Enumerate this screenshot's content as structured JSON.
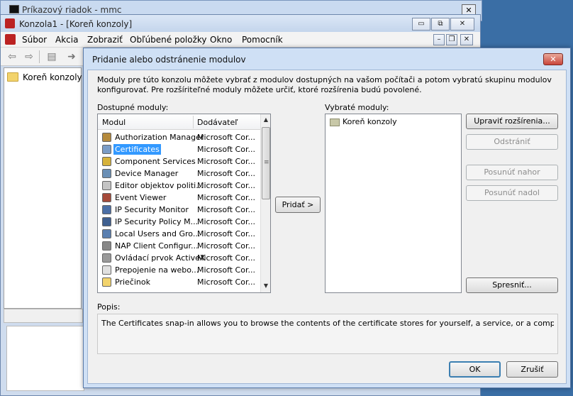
{
  "cmd_window": {
    "title": "Príkazový riadok - mmc",
    "close_label": "✕"
  },
  "console": {
    "title": "Konzola1 - [Koreň konzoly]",
    "menu": [
      "Súbor",
      "Akcia",
      "Zobraziť",
      "Obľúbené položky",
      "Okno",
      "Pomocník"
    ],
    "tree_root": "Koreň konzoly",
    "window_buttons": {
      "min": "▭",
      "max": "⧉",
      "close": "✕"
    },
    "mdi_buttons": {
      "min": "–",
      "max": "❐",
      "close": "✕"
    }
  },
  "dialog": {
    "title": "Pridanie alebo odstránenie modulov",
    "close_label": "✕",
    "description": "Moduly pre túto konzolu môžete vybrať z modulov dostupných na vašom počítači a potom vybratú skupinu modulov konfigurovať. Pre rozšíriteľné moduly môžete určiť, ktoré rozšírenia budú povolené.",
    "available_label": "Dostupné moduly:",
    "selected_label": "Vybraté moduly:",
    "columns": {
      "module": "Modul",
      "vendor": "Dodávateľ"
    },
    "available": [
      {
        "name": "Authorization Manager",
        "vendor": "Microsoft Cor...",
        "icon": "authorization-manager-icon",
        "color": "#b58a3c"
      },
      {
        "name": "Certificates",
        "vendor": "Microsoft Cor...",
        "icon": "certificates-icon",
        "color": "#7a9cc6",
        "selected": true
      },
      {
        "name": "Component Services",
        "vendor": "Microsoft Cor...",
        "icon": "component-services-icon",
        "color": "#d6b23a"
      },
      {
        "name": "Device Manager",
        "vendor": "Microsoft Cor...",
        "icon": "device-manager-icon",
        "color": "#6a8fb5"
      },
      {
        "name": "Editor objektov politi...",
        "vendor": "Microsoft Cor...",
        "icon": "policy-editor-icon",
        "color": "#c4c4c4"
      },
      {
        "name": "Event Viewer",
        "vendor": "Microsoft Cor...",
        "icon": "event-viewer-icon",
        "color": "#a54a3a"
      },
      {
        "name": "IP Security Monitor",
        "vendor": "Microsoft Cor...",
        "icon": "ip-security-monitor-icon",
        "color": "#4b6fa6"
      },
      {
        "name": "IP Security Policy M...",
        "vendor": "Microsoft Cor...",
        "icon": "ip-security-policy-icon",
        "color": "#3f5f8f"
      },
      {
        "name": "Local Users and Gro...",
        "vendor": "Microsoft Cor...",
        "icon": "local-users-icon",
        "color": "#5a7fb0"
      },
      {
        "name": "NAP Client Configur...",
        "vendor": "Microsoft Cor...",
        "icon": "nap-client-icon",
        "color": "#888888"
      },
      {
        "name": "Ovládací prvok ActiveX",
        "vendor": "Microsoft Cor...",
        "icon": "activex-control-icon",
        "color": "#9a9a9a"
      },
      {
        "name": "Prepojenie na webo...",
        "vendor": "Microsoft Cor...",
        "icon": "web-link-icon",
        "color": "#e0e0e0"
      },
      {
        "name": "Priečinok",
        "vendor": "Microsoft Cor...",
        "icon": "folder-icon",
        "color": "#f2d36c"
      }
    ],
    "selected": [
      {
        "name": "Koreň konzoly",
        "icon": "console-root-icon"
      }
    ],
    "buttons": {
      "add": "Pridať >",
      "edit_extensions": "Upraviť rozšírenia...",
      "remove": "Odstrániť",
      "move_up": "Posunúť nahor",
      "move_down": "Posunúť nadol",
      "advanced": "Spresniť...",
      "ok": "OK",
      "cancel": "Zrušiť"
    },
    "desc_label": "Popis:",
    "desc_text": "The Certificates snap-in allows you to browse the contents of the certificate stores for yourself, a service, or a computer."
  }
}
